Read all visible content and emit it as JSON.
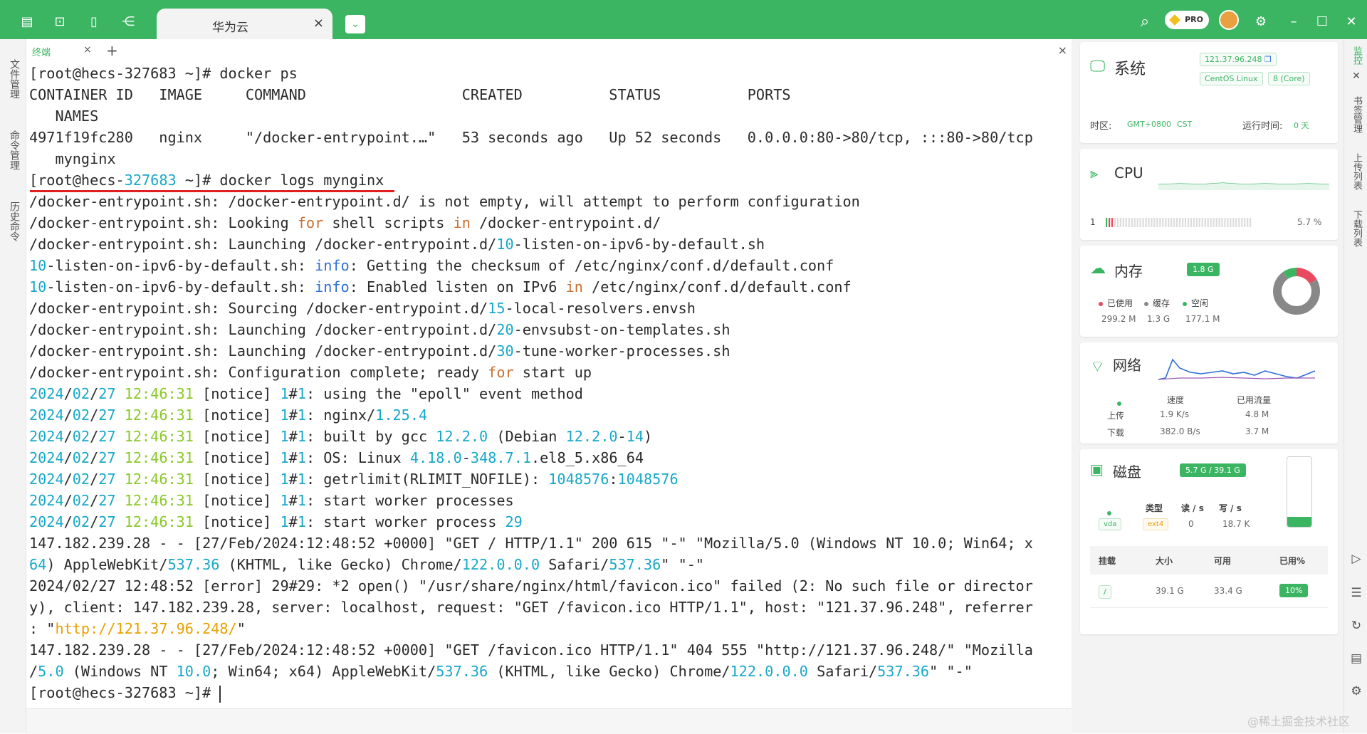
{
  "topbar": {
    "tab_title": "华为云",
    "tab_close": "×",
    "dropdown": "⌄",
    "pro_label": "PRO",
    "icons": {
      "files": "▤",
      "terminal": "⊡",
      "notes": "▯",
      "tree": "⋲",
      "search": "⌕",
      "settings": "⚙",
      "minimize": "–",
      "maximize": "☐",
      "close": "✕"
    }
  },
  "left_sidebar": {
    "items": [
      "文件管理",
      "命令管理",
      "历史命令"
    ]
  },
  "terminal": {
    "tab_label": "终端",
    "tab_close": "×",
    "add": "+",
    "close": "×"
  },
  "right_panel": {
    "system": {
      "title": "系统",
      "ip": "121.37.96.248",
      "os": "CentOS Linux",
      "cores": "8 (Core)",
      "timezone_label": "时区:",
      "timezone": "GMT+0800",
      "tz_abbr": "CST",
      "uptime_label": "运行时间:",
      "uptime": "0 天"
    },
    "cpu": {
      "title": "CPU",
      "core_index": "1",
      "usage": "5.7 %",
      "usage_fraction": 0.057
    },
    "memory": {
      "title": "内存",
      "total": "1.8 G",
      "used_label": "已使用",
      "used": "299.2 M",
      "cache_label": "缓存",
      "cache": "1.3 G",
      "free_label": "空闲",
      "free": "177.1 M",
      "colors": {
        "used": "#e84a5f",
        "cache": "#888888",
        "free": "#3cb563"
      }
    },
    "network": {
      "title": "网络",
      "speed_header": "速度",
      "traffic_header": "已用流量",
      "upload_label": "上传",
      "upload_speed": "1.9 K/s",
      "upload_total": "4.8 M",
      "download_label": "下载",
      "download_speed": "382.0 B/s",
      "download_total": "3.7 M"
    },
    "disk": {
      "title": "磁盘",
      "usage": "5.7 G / 39.1 G",
      "type_header": "类型",
      "read_header": "读 / s",
      "write_header": "写 / s",
      "device": "vda",
      "fs": "ext4",
      "read": "0",
      "write": "18.7 K",
      "mount_header": "挂载",
      "size_header": "大小",
      "avail_header": "可用",
      "used_pct_header": "已用%",
      "mount": "/",
      "size": "39.1 G",
      "avail": "33.4 G",
      "used_pct": "10%",
      "fill_fraction": 0.146
    }
  },
  "right_strip": {
    "items": [
      "监控",
      "书签管理",
      "上传列表",
      "下载列表"
    ],
    "close": "✕"
  },
  "watermark": "@稀土掘金技术社区"
}
